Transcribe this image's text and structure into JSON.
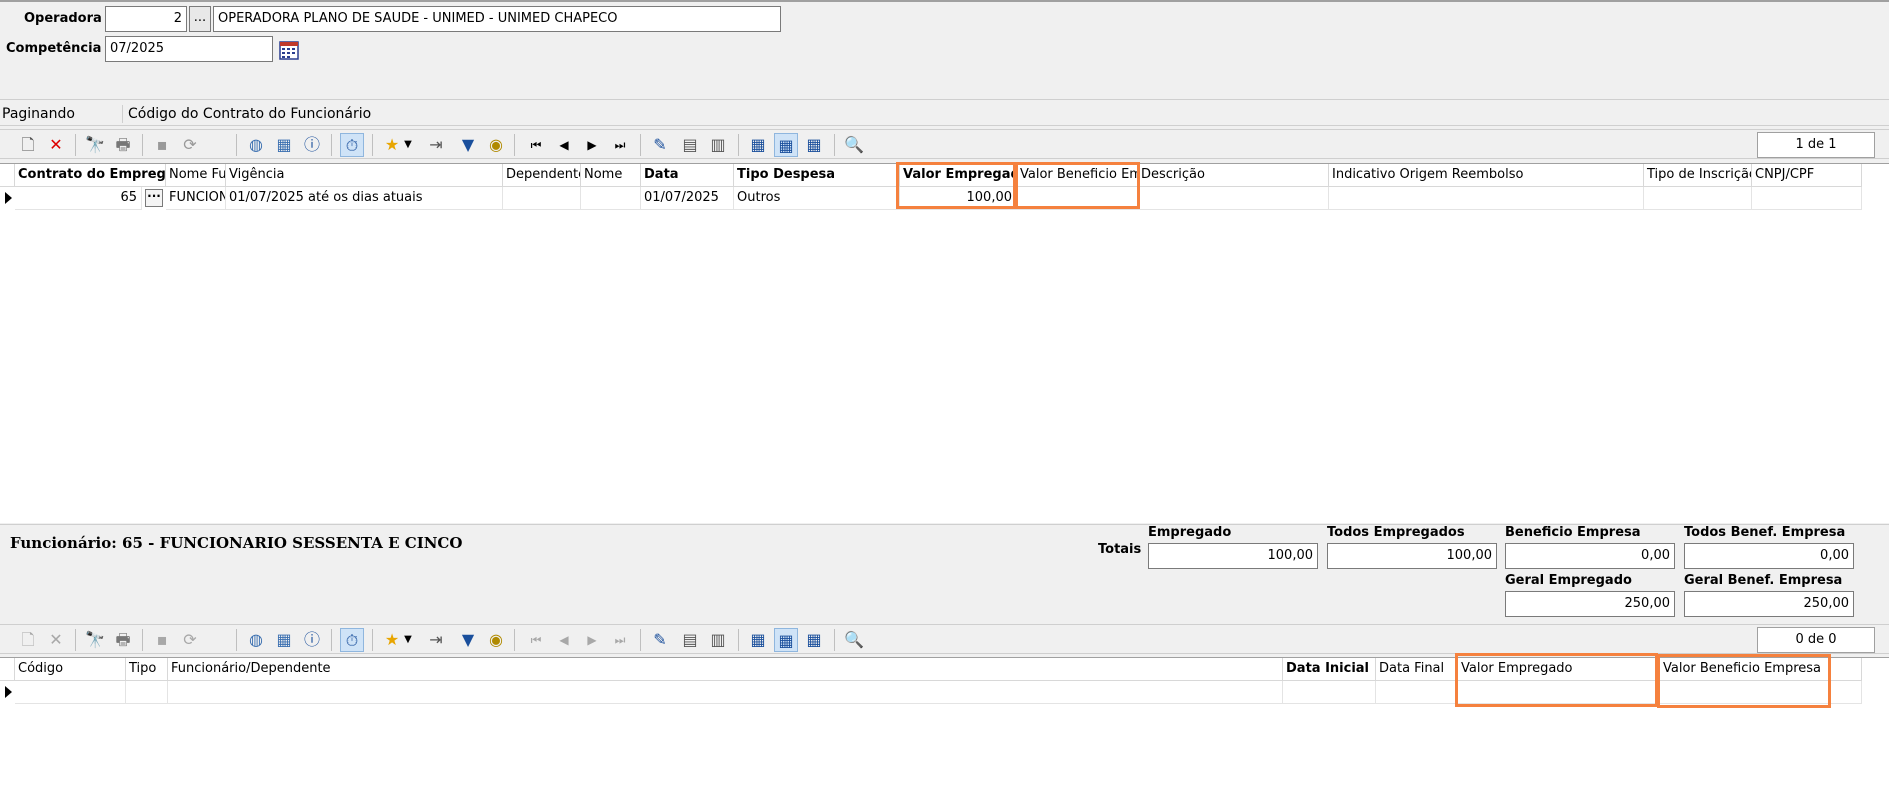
{
  "filters": {
    "operadora_label": "Operadora",
    "operadora_code": "2",
    "operadora_name": "OPERADORA PLANO DE SAUDE - UNIMED - UNIMED CHAPECO",
    "competencia_label": "Competência",
    "competencia_value": "07/2025"
  },
  "group_bar": {
    "paginando": "Paginando",
    "codigo": "Código do Contrato do Funcionário"
  },
  "toolbar_top": {
    "pager": "1 de 1"
  },
  "toolbar_bottom": {
    "pager": "0 de 0"
  },
  "grid_top": {
    "headers": {
      "contrato": "Contrato do Empregado",
      "nome_func": "Nome Funcionário",
      "vigencia": "Vigência",
      "dependente": "Dependente",
      "nome": "Nome",
      "data": "Data",
      "tipo_despesa": "Tipo Despesa",
      "valor_empregado": "Valor Empregado",
      "valor_beneficio": "Valor Beneficio Empresa",
      "descricao": "Descrição",
      "indicativo": "Indicativo Origem Reembolso",
      "tipo_inscricao": "Tipo de Inscrição",
      "cnpj": "CNPJ/CPF"
    },
    "row": {
      "contrato": "65",
      "nome_func": "FUNCIONARIO",
      "vigencia": "01/07/2025 até os dias atuais",
      "dependente": "",
      "nome": "",
      "data": "01/07/2025",
      "tipo_despesa": "Outros",
      "valor_empregado": "100,00",
      "valor_beneficio": ""
    }
  },
  "summary": {
    "funcionario": "Funcionário: 65 - FUNCIONARIO SESSENTA E CINCO",
    "totais_label": "Totais",
    "empregado_label": "Empregado",
    "empregado_value": "100,00",
    "todos_empregados_label": "Todos Empregados",
    "todos_empregados_value": "100,00",
    "beneficio_empresa_label": "Beneficio Empresa",
    "beneficio_empresa_value": "0,00",
    "todos_benef_label": "Todos Benef. Empresa",
    "todos_benef_value": "0,00",
    "geral_empregado_label": "Geral Empregado",
    "geral_empregado_value": "250,00",
    "geral_benef_label": "Geral Benef. Empresa",
    "geral_benef_value": "250,00"
  },
  "grid_bottom": {
    "headers": {
      "codigo": "Código",
      "tipo": "Tipo",
      "funcionario": "Funcionário/Dependente",
      "data_inicial": "Data Inicial",
      "data_final": "Data Final",
      "valor_empregado": "Valor Empregado",
      "valor_beneficio": "Valor Beneficio Empresa"
    }
  },
  "colors": {
    "highlight": "#f5813e"
  }
}
